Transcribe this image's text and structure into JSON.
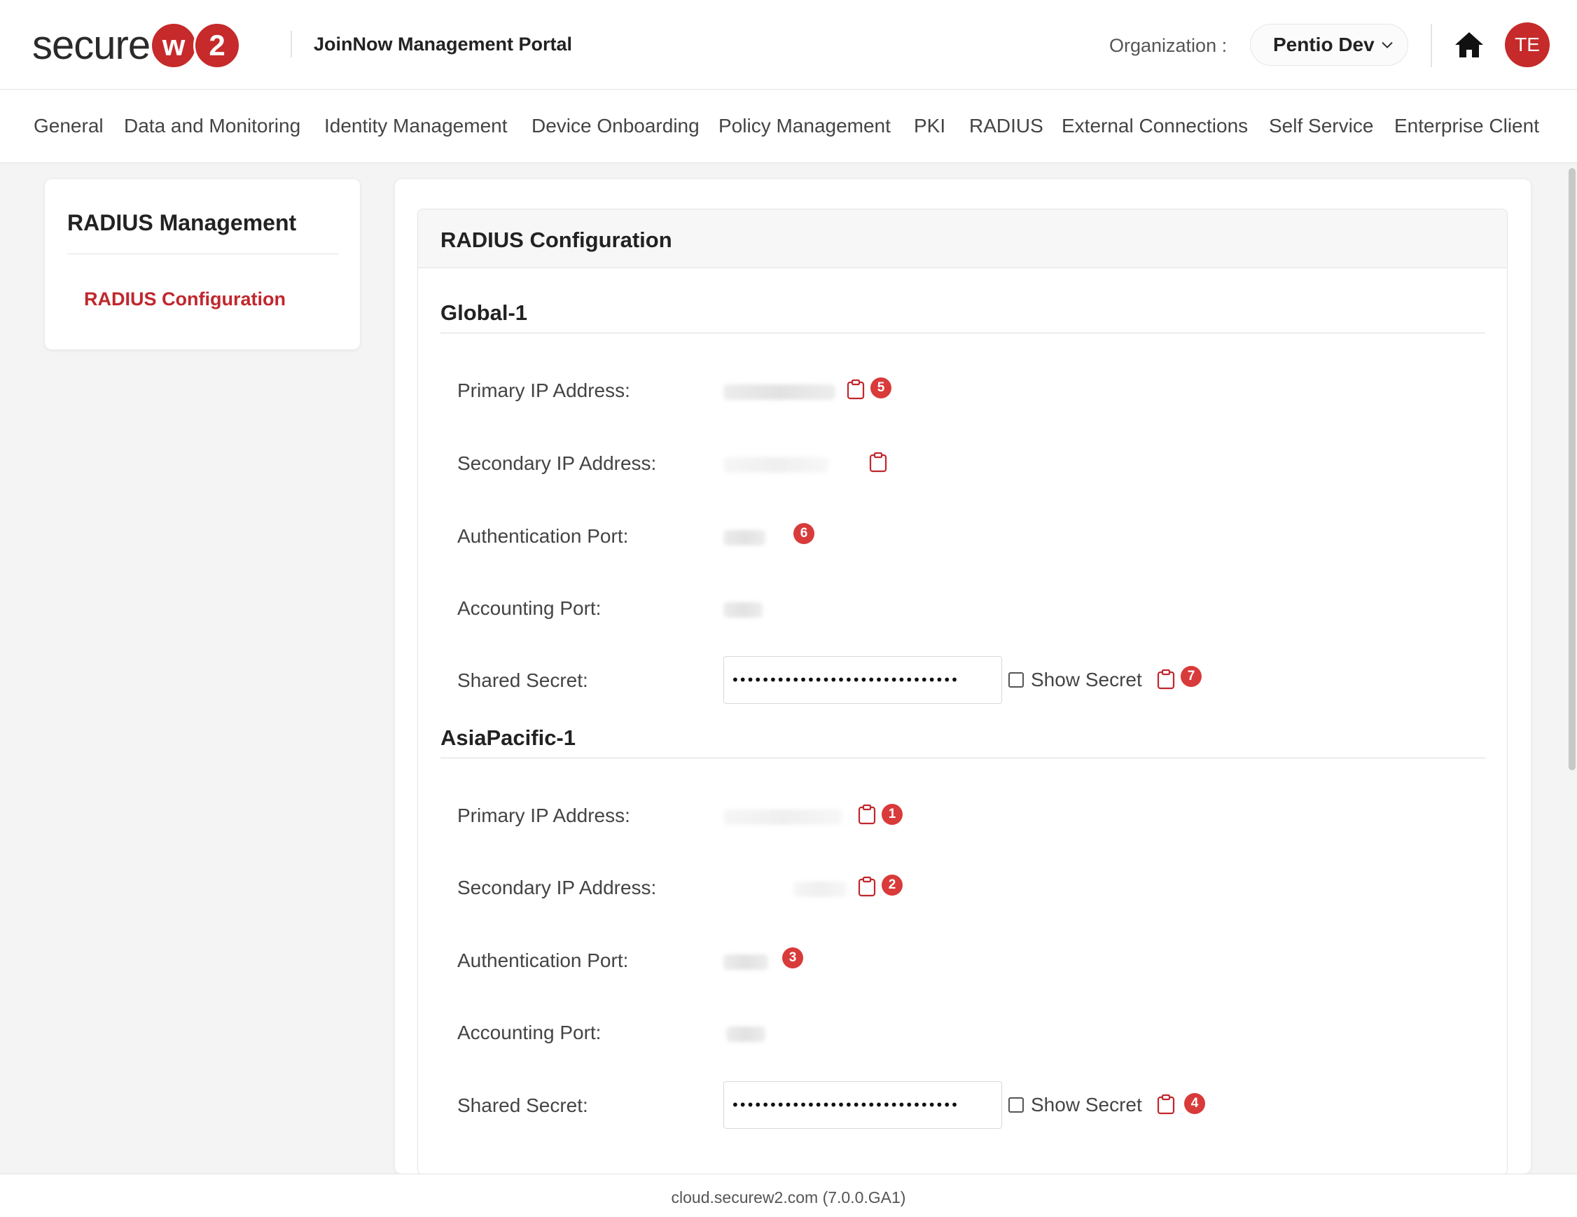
{
  "header": {
    "logo_text": "secure",
    "logo_w": "w",
    "logo_2": "2",
    "portal_title": "JoinNow Management Portal",
    "org_label": "Organization :",
    "org_value": "Pentio Dev",
    "avatar_initials": "TE",
    "brand_color": "#c62a2a"
  },
  "nav": {
    "items": [
      "General",
      "Data and Monitoring",
      "Identity Management",
      "Device Onboarding",
      "Policy Management",
      "PKI",
      "RADIUS",
      "External Connections",
      "Self Service",
      "Enterprise Client"
    ]
  },
  "sidebar": {
    "title": "RADIUS Management",
    "active_item": "RADIUS Configuration"
  },
  "main": {
    "panel_title": "RADIUS Configuration",
    "sections": [
      {
        "title": "Global-1",
        "labels": {
          "primary_ip": "Primary IP Address:",
          "secondary_ip": "Secondary IP Address:",
          "auth_port": "Authentication Port:",
          "acct_port": "Accounting Port:",
          "shared_secret": "Shared Secret:"
        },
        "shared_secret_value": "••••••••••••••••••••••••••••••",
        "show_secret_label": "Show Secret",
        "badges": {
          "primary_ip": "5",
          "auth_port": "6",
          "shared_secret": "7"
        }
      },
      {
        "title": "AsiaPacific-1",
        "labels": {
          "primary_ip": "Primary IP Address:",
          "secondary_ip": "Secondary IP Address:",
          "auth_port": "Authentication Port:",
          "acct_port": "Accounting Port:",
          "shared_secret": "Shared Secret:"
        },
        "shared_secret_value": "••••••••••••••••••••••••••••••",
        "show_secret_label": "Show Secret",
        "badges": {
          "primary_ip": "1",
          "secondary_ip": "2",
          "auth_port": "3",
          "shared_secret": "4"
        }
      }
    ]
  },
  "footer": {
    "text": "cloud.securew2.com (7.0.0.GA1)"
  },
  "colors": {
    "accent_red": "#c0272d",
    "badge_red": "#d93a3a"
  }
}
